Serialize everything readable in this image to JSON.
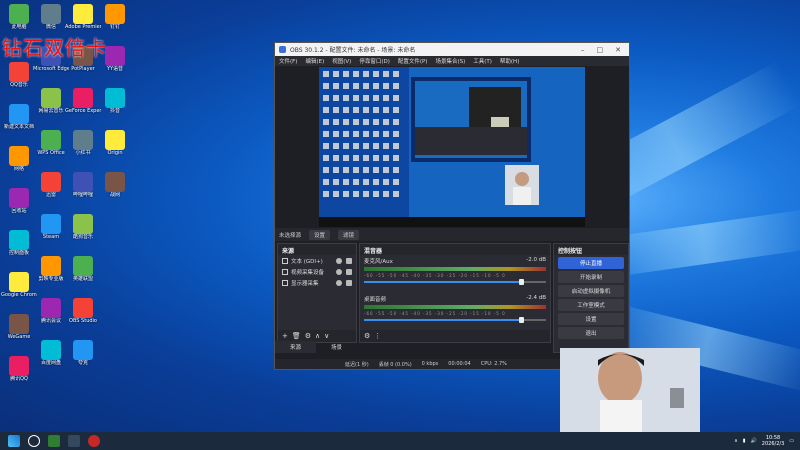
{
  "overlay_title": "钻石双倍卡",
  "obs": {
    "window_title": "OBS 30.1.2 - 配置文件: 未命名 - 场景: 未命名",
    "menu": [
      "文件(F)",
      "编辑(E)",
      "视图(V)",
      "停靠窗口(D)",
      "配置文件(P)",
      "场景集合(S)",
      "工具(T)",
      "帮助(H)"
    ],
    "context_bar": {
      "no_source": "未选择源",
      "properties": "设置",
      "filters": "滤镜"
    },
    "sources": {
      "header": "来源",
      "items": [
        "文本 (GDI+)",
        "视频采集设备",
        "显示器采集"
      ]
    },
    "mixer": {
      "header": "混音器",
      "channels": [
        {
          "name": "麦克风/Aux",
          "db": "-2.0 dB"
        },
        {
          "name": "桌面音频",
          "db": "-2.4 dB"
        }
      ],
      "ticks": "-60 -55 -50 -45 -40 -35 -30 -25 -20 -15 -10 -5 0"
    },
    "controls": {
      "header": "控制按钮",
      "buttons": [
        "停止直播",
        "开始录制",
        "启动虚拟摄像机",
        "工作室模式",
        "设置",
        "退出"
      ]
    },
    "tabs": [
      "来源",
      "场景"
    ],
    "status": {
      "dropped": "丢帧 0 (0.0%)",
      "bitrate": "0 kbps",
      "time": "00:00:04",
      "cpu": "CPU: 2.7%",
      "delay": "延迟(1 秒)"
    }
  },
  "desktop_icons": [
    "此电脑",
    "QQ音乐",
    "新建文本文档",
    "网络",
    "回收站",
    "控制面板",
    "Google Chrome",
    "WeGame",
    "腾讯QQ",
    "微信",
    "Microsoft Edge",
    "网易云音乐",
    "WPS Office",
    "迅雷",
    "Steam",
    "剪映专业版",
    "腾讯会议",
    "百度网盘",
    "Adobe Premiere",
    "PotPlayer",
    "GeForce Experience",
    "小红书",
    "哔哩哔哩",
    "酷狗音乐",
    "英雄联盟",
    "OBS Studio",
    "夸克",
    "钉钉",
    "YY语音",
    "抖音",
    "Origin",
    "战网"
  ],
  "taskbar": {
    "time": "10:58",
    "date": "2026/2/3"
  },
  "colors": {
    "accent": "#2f63d6",
    "overlay_text": "#e11111",
    "wallpaper": "#0b5ac2"
  }
}
